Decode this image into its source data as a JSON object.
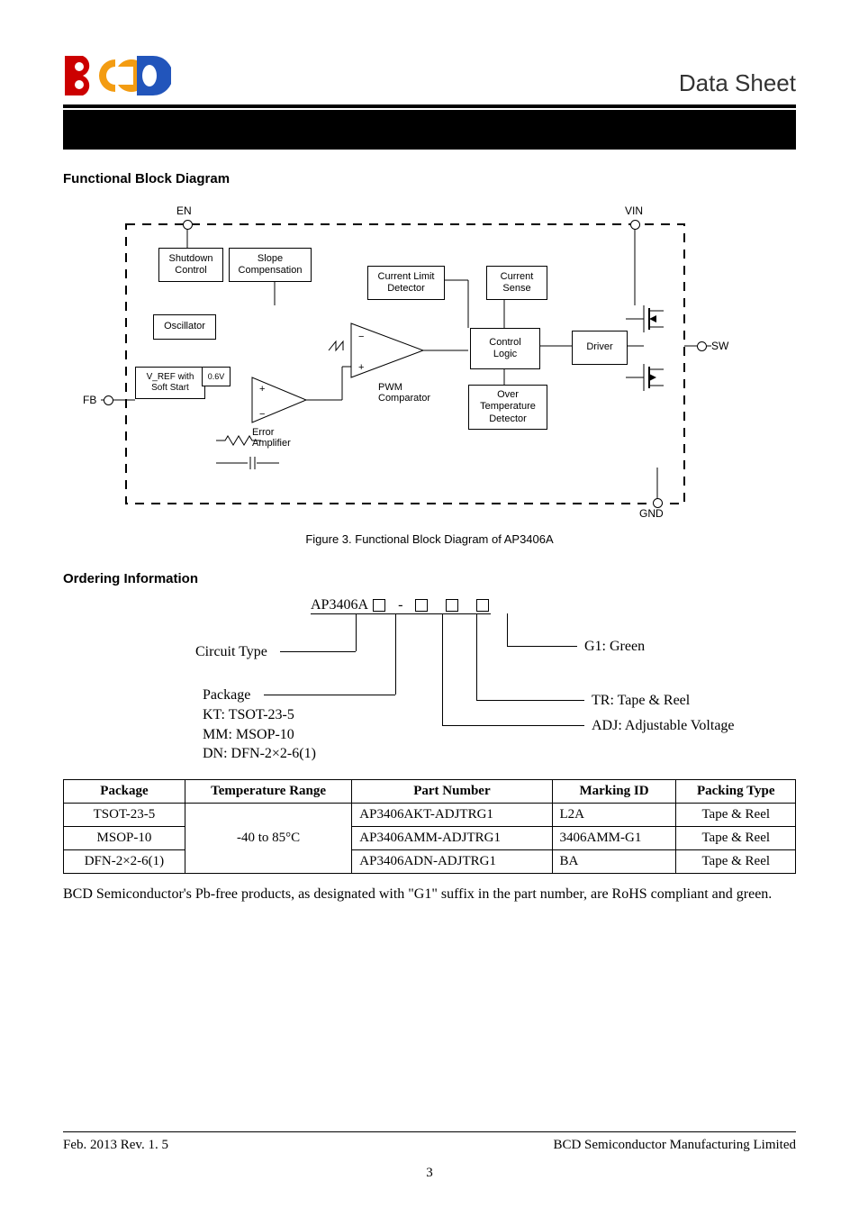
{
  "header": {
    "title_right": "Data Sheet"
  },
  "sections": {
    "func_block": "Functional Block Diagram",
    "ordering": "Ordering Information"
  },
  "figure": {
    "caption": "Figure 3. Functional Block Diagram of AP3406A"
  },
  "diagram": {
    "pins": {
      "en": "EN",
      "vin": "VIN",
      "sw": "SW",
      "gnd": "GND",
      "fb": "FB"
    },
    "blocks": {
      "shutdown": "Shutdown\nControl",
      "slope": "Slope\nCompensation",
      "oscillator": "Oscillator",
      "vref": "V_REF with\nSoft Start",
      "vref_val": "0.6V",
      "error": "Error\nAmplifier",
      "pwm": "PWM\nComparator",
      "curlimit": "Current Limit\nDetector",
      "cursense": "Current\nSense",
      "ctrllogic": "Control\nLogic",
      "driver": "Driver",
      "ovtemp": "Over\nTemperature\nDetector"
    }
  },
  "ordering": {
    "top_code": "AP3406A",
    "dash": "-",
    "circuit_type": "Circuit Type",
    "package_label": "Package",
    "package_lines": "KT: TSOT-23-5\nMM: MSOP-10\nDN: DFN-2×2-6(1)",
    "g1": "G1: Green",
    "tr": "TR: Tape & Reel",
    "adj": "ADJ: Adjustable Voltage"
  },
  "table": {
    "headers": {
      "package": "Package",
      "temp": "Temperature Range",
      "part": "Part Number",
      "marking": "Marking ID",
      "packing": "Packing Type"
    },
    "temp_val": "-40 to 85°C",
    "rows": [
      {
        "pkg": "TSOT-23-5",
        "part": "AP3406AKT-ADJTRG1",
        "mark": "L2A",
        "pack": "Tape & Reel"
      },
      {
        "pkg": "MSOP-10",
        "part": "AP3406AMM-ADJTRG1",
        "mark": "3406AMM-G1",
        "pack": "Tape & Reel"
      },
      {
        "pkg": "DFN-2×2-6(1)",
        "part": "AP3406ADN-ADJTRG1",
        "mark": "BA",
        "pack": "Tape & Reel"
      }
    ]
  },
  "note": "BCD Semiconductor's Pb-free products, as designated with \"G1\" suffix in the part number, are RoHS compliant and green.",
  "footer": {
    "left": "Feb. 2013   Rev. 1. 5",
    "right": "BCD Semiconductor Manufacturing Limited",
    "page": "3"
  }
}
